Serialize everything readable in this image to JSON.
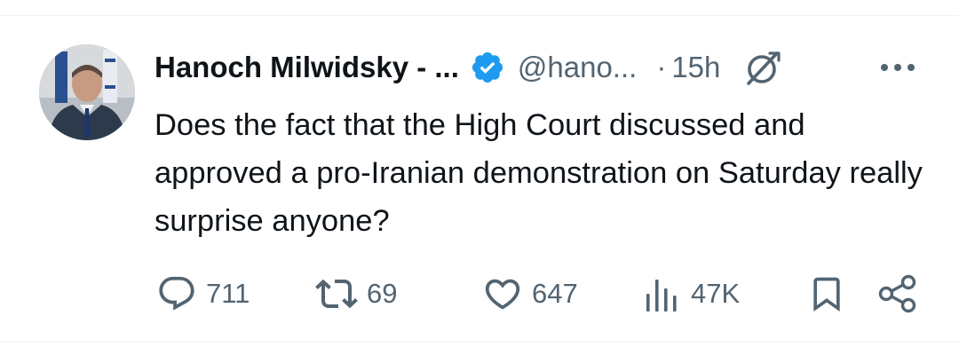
{
  "author": {
    "name": "Hanoch Milwidsky - ...",
    "handle": "@hano...",
    "separator": "·",
    "time": "15h",
    "verified": true
  },
  "tweet": {
    "text": "Does the fact that the High Court discussed and approved a pro-Iranian demonstration on Saturday really surprise anyone?"
  },
  "actions": {
    "replies": "711",
    "reposts": "69",
    "likes": "647",
    "views": "47K"
  },
  "icons": {
    "verified": "verified-badge-icon",
    "grok": "grok-icon",
    "more": "more-options-icon",
    "reply": "reply-icon",
    "repost": "repost-icon",
    "like": "heart-icon",
    "views": "views-icon",
    "bookmark": "bookmark-icon",
    "share": "share-icon"
  },
  "colors": {
    "text": "#0f1419",
    "secondary": "#536471",
    "verified_blue": "#1d9bf0",
    "divider": "#eff3f4"
  }
}
